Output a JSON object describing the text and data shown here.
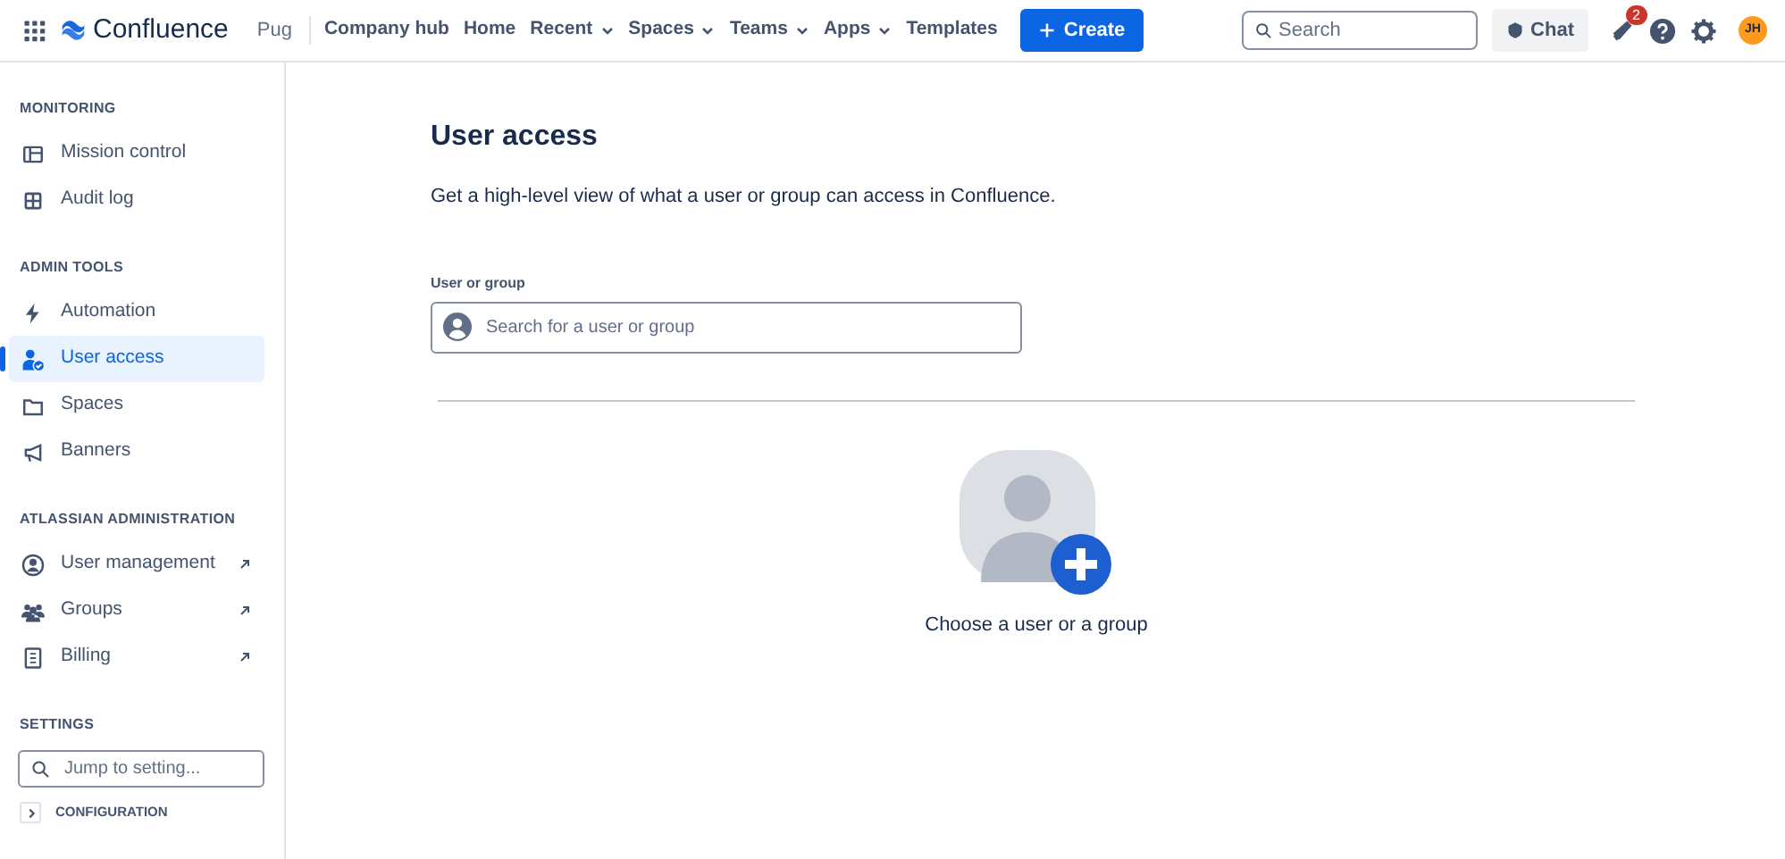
{
  "navbar": {
    "product": "Confluence",
    "space": "Pug",
    "links": [
      {
        "label": "Company hub",
        "dropdown": false
      },
      {
        "label": "Home",
        "dropdown": false
      },
      {
        "label": "Recent",
        "dropdown": true
      },
      {
        "label": "Spaces",
        "dropdown": true
      },
      {
        "label": "Teams",
        "dropdown": true
      },
      {
        "label": "Apps",
        "dropdown": true
      },
      {
        "label": "Templates",
        "dropdown": false
      }
    ],
    "create": "Create",
    "search": {
      "placeholder": "Search"
    },
    "chat": "Chat",
    "notifications": "2",
    "avatar": "JH"
  },
  "sidebar": {
    "sections": [
      {
        "heading": "MONITORING",
        "items": [
          {
            "label": "Mission control",
            "selected": false,
            "external": false
          },
          {
            "label": "Audit log",
            "selected": false,
            "external": false
          }
        ]
      },
      {
        "heading": "ADMIN TOOLS",
        "items": [
          {
            "label": "Automation",
            "selected": false,
            "external": false
          },
          {
            "label": "User access",
            "selected": true,
            "external": false
          },
          {
            "label": "Spaces",
            "selected": false,
            "external": false
          },
          {
            "label": "Banners",
            "selected": false,
            "external": false
          }
        ]
      },
      {
        "heading": "ATLASSIAN ADMINISTRATION",
        "items": [
          {
            "label": "User management",
            "selected": false,
            "external": true
          },
          {
            "label": "Groups",
            "selected": false,
            "external": true
          },
          {
            "label": "Billing",
            "selected": false,
            "external": true
          }
        ]
      }
    ],
    "settings": {
      "heading": "SETTINGS",
      "search": {
        "placeholder": "Jump to setting..."
      },
      "groups": [
        {
          "label": "CONFIGURATION",
          "expanded": false
        }
      ]
    }
  },
  "main": {
    "title": "User access",
    "description": "Get a high-level view of what a user or group can access in Confluence.",
    "field": {
      "label": "User or group",
      "placeholder": "Search for a user or group"
    },
    "empty_state": "Choose a user or a group"
  }
}
